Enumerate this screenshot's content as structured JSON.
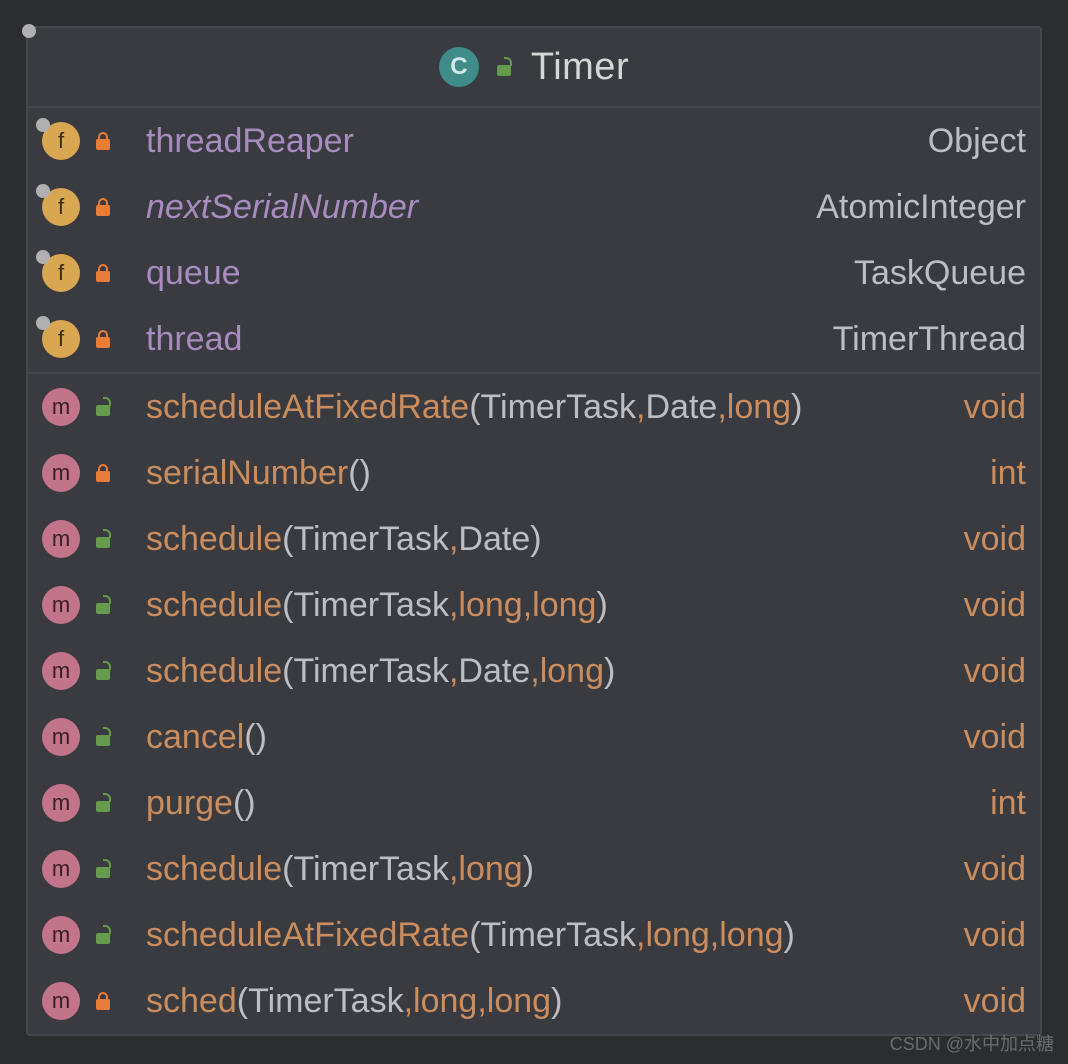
{
  "header": {
    "class_name": "Timer",
    "class_icon_letter": "C",
    "visibility": "public"
  },
  "fields": [
    {
      "icon": "f",
      "access": "private",
      "name": "threadReaper",
      "italic": false,
      "type": "Object",
      "static_marker": true
    },
    {
      "icon": "f",
      "access": "private",
      "name": "nextSerialNumber",
      "italic": true,
      "type": "AtomicInteger",
      "static_marker": true
    },
    {
      "icon": "f",
      "access": "private",
      "name": "queue",
      "italic": false,
      "type": "TaskQueue",
      "static_marker": true
    },
    {
      "icon": "f",
      "access": "private",
      "name": "thread",
      "italic": false,
      "type": "TimerThread",
      "static_marker": true
    }
  ],
  "methods": [
    {
      "icon": "m",
      "access": "public",
      "name": "scheduleAtFixedRate",
      "params": [
        {
          "t": "TimerTask",
          "p": false
        },
        {
          "t": "Date",
          "p": false
        },
        {
          "t": "long",
          "p": true
        }
      ],
      "ret": "void",
      "static_marker": false
    },
    {
      "icon": "m",
      "access": "private",
      "name": "serialNumber",
      "params": [],
      "ret": "int",
      "static_marker": true
    },
    {
      "icon": "m",
      "access": "public",
      "name": "schedule",
      "params": [
        {
          "t": "TimerTask",
          "p": false
        },
        {
          "t": "Date",
          "p": false
        }
      ],
      "ret": "void",
      "static_marker": false
    },
    {
      "icon": "m",
      "access": "public",
      "name": "schedule",
      "params": [
        {
          "t": "TimerTask",
          "p": false
        },
        {
          "t": "long",
          "p": true
        },
        {
          "t": "long",
          "p": true
        }
      ],
      "ret": "void",
      "static_marker": false
    },
    {
      "icon": "m",
      "access": "public",
      "name": "schedule",
      "params": [
        {
          "t": "TimerTask",
          "p": false
        },
        {
          "t": "Date",
          "p": false
        },
        {
          "t": "long",
          "p": true
        }
      ],
      "ret": "void",
      "static_marker": false
    },
    {
      "icon": "m",
      "access": "public",
      "name": "cancel",
      "params": [],
      "ret": "void",
      "static_marker": false
    },
    {
      "icon": "m",
      "access": "public",
      "name": "purge",
      "params": [],
      "ret": "int",
      "static_marker": false
    },
    {
      "icon": "m",
      "access": "public",
      "name": "schedule",
      "params": [
        {
          "t": "TimerTask",
          "p": false
        },
        {
          "t": "long",
          "p": true
        }
      ],
      "ret": "void",
      "static_marker": false
    },
    {
      "icon": "m",
      "access": "public",
      "name": "scheduleAtFixedRate",
      "params": [
        {
          "t": "TimerTask",
          "p": false
        },
        {
          "t": "long",
          "p": true
        },
        {
          "t": "long",
          "p": true
        }
      ],
      "ret": "void",
      "static_marker": false
    },
    {
      "icon": "m",
      "access": "private",
      "name": "sched",
      "params": [
        {
          "t": "TimerTask",
          "p": false
        },
        {
          "t": "long",
          "p": true
        },
        {
          "t": "long",
          "p": true
        }
      ],
      "ret": "void",
      "static_marker": false
    }
  ],
  "watermark": "CSDN @水中加点糖"
}
